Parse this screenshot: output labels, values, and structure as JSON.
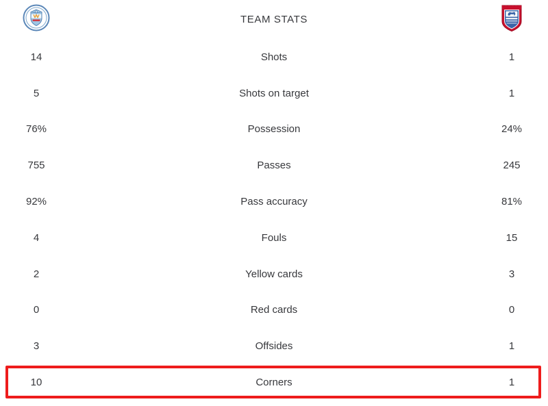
{
  "header": {
    "title": "TEAM STATS",
    "home_team": {
      "name": "Manchester City",
      "crest": "manchester-city-crest"
    },
    "away_team": {
      "name": "Ipswich Town",
      "crest": "ipswich-town-crest"
    }
  },
  "colors": {
    "text": "#37383c",
    "background": "#ffffff",
    "highlight": "#ee1c1c",
    "home_crest_primary": "#8fbbdd",
    "home_crest_outline": "#2e5f8f",
    "away_crest_red": "#c8102e",
    "away_crest_blue": "#3a64a8"
  },
  "rows": [
    {
      "label": "Shots",
      "home": "14",
      "away": "1",
      "highlighted": false
    },
    {
      "label": "Shots on target",
      "home": "5",
      "away": "1",
      "highlighted": false
    },
    {
      "label": "Possession",
      "home": "76%",
      "away": "24%",
      "highlighted": false
    },
    {
      "label": "Passes",
      "home": "755",
      "away": "245",
      "highlighted": false
    },
    {
      "label": "Pass accuracy",
      "home": "92%",
      "away": "81%",
      "highlighted": false
    },
    {
      "label": "Fouls",
      "home": "4",
      "away": "15",
      "highlighted": false
    },
    {
      "label": "Yellow cards",
      "home": "2",
      "away": "3",
      "highlighted": false
    },
    {
      "label": "Red cards",
      "home": "0",
      "away": "0",
      "highlighted": false
    },
    {
      "label": "Offsides",
      "home": "3",
      "away": "1",
      "highlighted": false
    },
    {
      "label": "Corners",
      "home": "10",
      "away": "1",
      "highlighted": true
    }
  ]
}
